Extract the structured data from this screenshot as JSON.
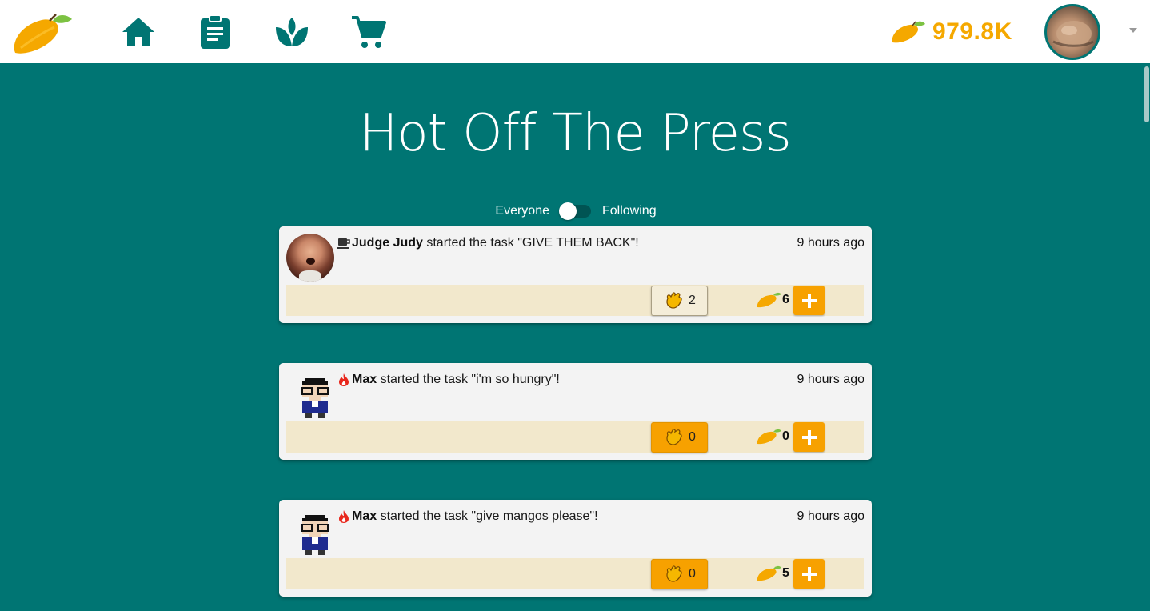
{
  "nav": {
    "logo_icon": "mango-logo-icon",
    "items": [
      {
        "name": "home",
        "icon": "home-icon"
      },
      {
        "name": "tasks",
        "icon": "clipboard-icon"
      },
      {
        "name": "garden",
        "icon": "sprout-icon"
      },
      {
        "name": "shop",
        "icon": "cart-icon"
      }
    ],
    "balance": "979.8K",
    "balance_icon": "mango-icon",
    "profile_icon": "avatar",
    "accent_color": "#007573",
    "mango_color": "#f5a800"
  },
  "page": {
    "title": "Hot Off The Press"
  },
  "feed_toggle": {
    "left_label": "Everyone",
    "right_label": "Following",
    "selected": "Everyone"
  },
  "posts": [
    {
      "user": "Judge Judy",
      "status_icon": "coffee-icon",
      "text": " started the task \"GIVE THEM BACK\"!",
      "time": "9 hours ago",
      "claps": "2",
      "clapped": true,
      "mangos": "6"
    },
    {
      "user": "Max",
      "status_icon": "fire-icon",
      "text": " started the task \"i'm so hungry\"!",
      "time": "9 hours ago",
      "claps": "0",
      "clapped": false,
      "mangos": "0"
    },
    {
      "user": "Max",
      "status_icon": "fire-icon",
      "text": " started the task \"give mangos please\"!",
      "time": "9 hours ago",
      "claps": "0",
      "clapped": false,
      "mangos": "5"
    }
  ]
}
